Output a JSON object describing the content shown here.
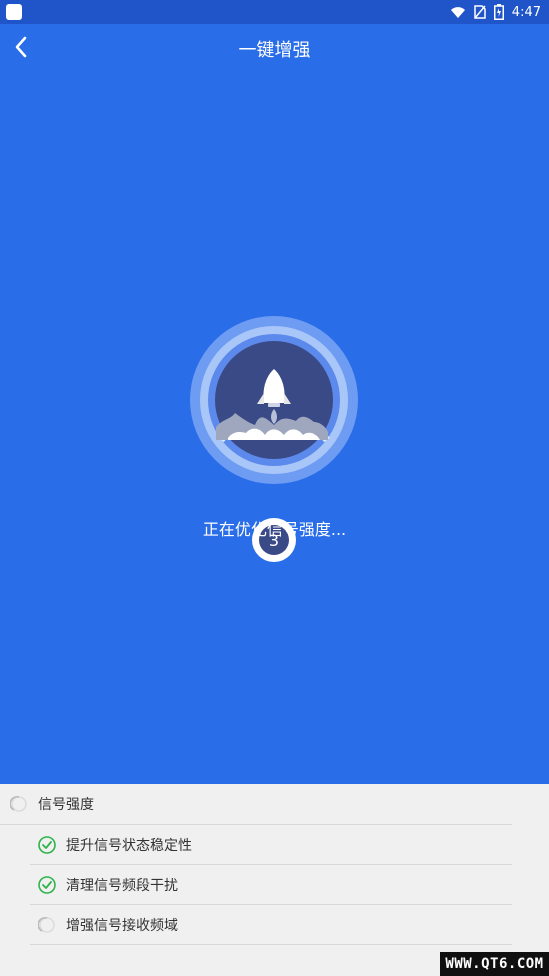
{
  "status_bar": {
    "time": "4:47"
  },
  "header": {
    "title": "一键增强"
  },
  "main": {
    "countdown": "3",
    "status_text": "正在优化信号强度..."
  },
  "list": {
    "main_item": "信号强度",
    "items": [
      {
        "label": "提升信号状态稳定性",
        "state": "done"
      },
      {
        "label": "清理信号频段干扰",
        "state": "done"
      },
      {
        "label": "增强信号接收频域",
        "state": "loading"
      }
    ]
  },
  "watermark": "WWW.QT6.COM",
  "colors": {
    "background": "#2a6de8",
    "status_bar": "#1f55c9",
    "panel": "#f0f0f0",
    "check": "#2db34a"
  }
}
